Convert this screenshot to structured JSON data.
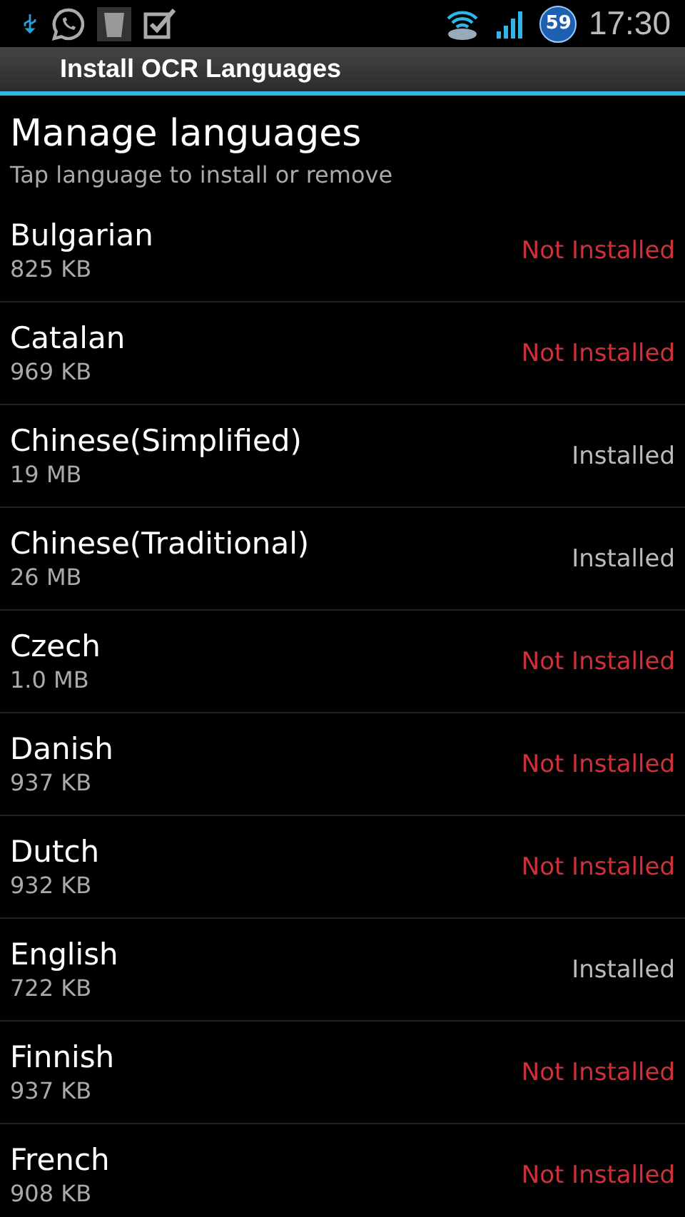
{
  "status_bar": {
    "badge": "59",
    "time": "17:30"
  },
  "action_bar": {
    "title": "Install OCR Languages"
  },
  "header": {
    "title": "Manage languages",
    "subtitle": "Tap language to install or remove"
  },
  "languages": [
    {
      "name": "Bulgarian",
      "size": "825 KB",
      "status": "Not Installed",
      "installed": false
    },
    {
      "name": "Catalan",
      "size": "969 KB",
      "status": "Not Installed",
      "installed": false
    },
    {
      "name": "Chinese(Simplified)",
      "size": "19 MB",
      "status": "Installed",
      "installed": true
    },
    {
      "name": "Chinese(Traditional)",
      "size": "26 MB",
      "status": "Installed",
      "installed": true
    },
    {
      "name": "Czech",
      "size": "1.0 MB",
      "status": "Not Installed",
      "installed": false
    },
    {
      "name": "Danish",
      "size": "937 KB",
      "status": "Not Installed",
      "installed": false
    },
    {
      "name": "Dutch",
      "size": "932 KB",
      "status": "Not Installed",
      "installed": false
    },
    {
      "name": "English",
      "size": "722 KB",
      "status": "Installed",
      "installed": true
    },
    {
      "name": "Finnish",
      "size": "937 KB",
      "status": "Not Installed",
      "installed": false
    },
    {
      "name": "French",
      "size": "908 KB",
      "status": "Not Installed",
      "installed": false
    }
  ]
}
